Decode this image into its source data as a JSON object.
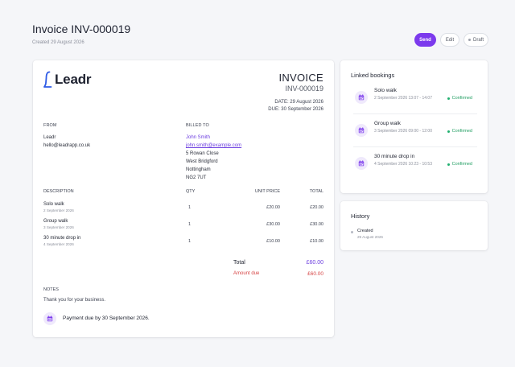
{
  "header": {
    "title": "Invoice INV-000019",
    "created": "Created 29 August 2026",
    "send_label": "Send",
    "edit_label": "Edit",
    "status_label": "Draft"
  },
  "invoice": {
    "brand": "Leadr",
    "heading": "INVOICE",
    "number": "INV-000019",
    "date": "DATE: 29 August 2026",
    "due": "DUE: 30 September 2026",
    "from": {
      "label": "FROM",
      "name": "Leadr",
      "email": "hello@leadrapp.co.uk"
    },
    "billed_to": {
      "label": "BILLED TO",
      "name": "John Smith",
      "email": "john.smith@example.com",
      "address": [
        "5 Rowan Close",
        "West Bridgford",
        "Nottingham",
        "NG2 7UT"
      ]
    },
    "columns": [
      "DESCRIPTION",
      "QTY",
      "UNIT PRICE",
      "TOTAL"
    ],
    "items": [
      {
        "name": "Solo walk",
        "date": "2 September 2026",
        "qty": "1",
        "unit": "£20.00",
        "total": "£20.00"
      },
      {
        "name": "Group walk",
        "date": "3 September 2026",
        "qty": "1",
        "unit": "£30.00",
        "total": "£30.00"
      },
      {
        "name": "30 minute drop in",
        "date": "4 September 2026",
        "qty": "1",
        "unit": "£10.00",
        "total": "£10.00"
      }
    ],
    "total_label": "Total",
    "total_value": "£60.00",
    "amount_due_label": "Amount due",
    "amount_due_value": "£60.00",
    "notes_label": "NOTES",
    "notes_text": "Thank you for your business.",
    "payment_due": "Payment due by 30 September 2026."
  },
  "linked": {
    "title": "Linked bookings",
    "bookings": [
      {
        "name": "Solo walk",
        "time": "2 September 2026 13:07 - 14:07",
        "status": "Confirmed"
      },
      {
        "name": "Group walk",
        "time": "3 September 2026 09:00 - 12:00",
        "status": "Confirmed"
      },
      {
        "name": "30 minute drop in",
        "time": "4 September 2026 10:23 - 10:53",
        "status": "Confirmed"
      }
    ]
  },
  "history": {
    "title": "History",
    "events": [
      {
        "name": "Created",
        "date": "29 August 2026"
      }
    ]
  },
  "colors": {
    "accent": "#7c3aed",
    "link": "#6d3fe0",
    "danger": "#d64545",
    "success": "#1f9d60",
    "background": "#f5f6f9"
  },
  "icons": {
    "logo": "leadr-logo-icon",
    "calendar": "calendar-icon",
    "status_dot": "status-dot-icon"
  }
}
